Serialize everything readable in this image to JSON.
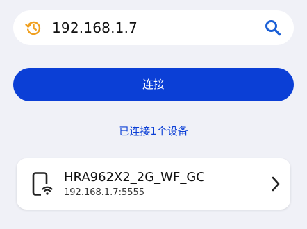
{
  "search": {
    "value": "192.168.1.7"
  },
  "actions": {
    "connect_label": "连接"
  },
  "status": {
    "connected_text": "已连接1个设备"
  },
  "devices": [
    {
      "name": "HRA962X2_2G_WF_GC",
      "address": "192.168.1.7:5555",
      "icon": "phone-wifi-icon"
    }
  ],
  "colors": {
    "accent": "#0b3fd6",
    "history_icon": "#f0a020",
    "search_icon": "#1a5fd6",
    "background": "#f0f1f7"
  }
}
